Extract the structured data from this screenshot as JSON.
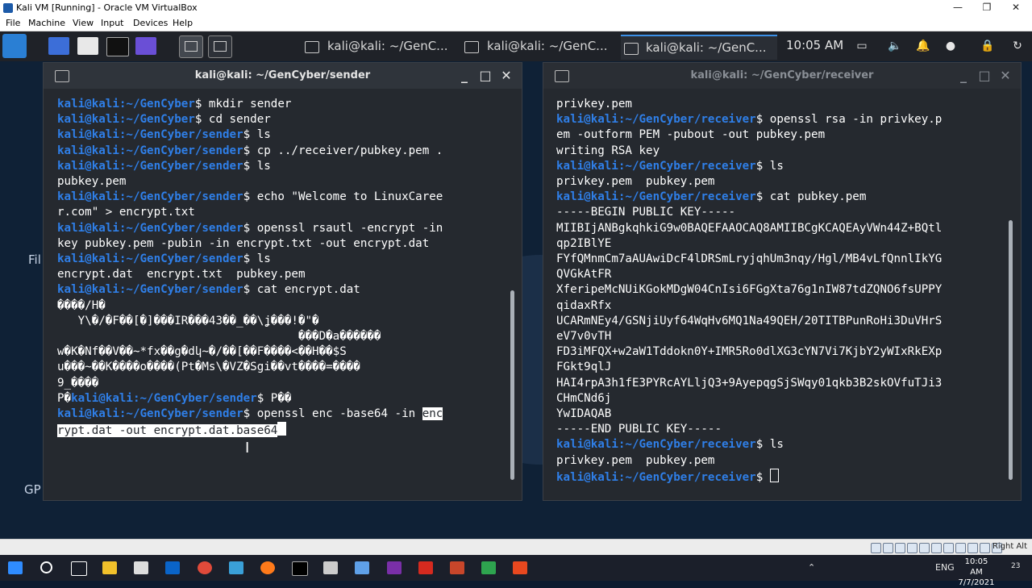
{
  "vbox": {
    "title": "Kali VM [Running] - Oracle VM VirtualBox",
    "menu": [
      "File",
      "Machine",
      "View",
      "Input",
      "Devices",
      "Help"
    ],
    "status_right": "Right Alt"
  },
  "panel": {
    "tasks": [
      "kali@kali: ~/GenC...",
      "kali@kali: ~/GenC...",
      "kali@kali: ~/GenC..."
    ],
    "time": "10:05 AM"
  },
  "desktop": {
    "labels": [
      "Fil",
      "GP"
    ]
  },
  "sender": {
    "title": "kali@kali: ~/GenCyber/sender",
    "prompt_user": "kali@kali",
    "lines": [
      {
        "path": ":~/GenCyber",
        "cmd": "$ mkdir sender"
      },
      {
        "path": ":~/GenCyber",
        "cmd": "$ cd sender"
      },
      {
        "path": ":~/GenCyber/sender",
        "cmd": "$ ls"
      },
      {
        "path": ":~/GenCyber/sender",
        "cmd": "$ cp ../receiver/pubkey.pem ."
      },
      {
        "path": ":~/GenCyber/sender",
        "cmd": "$ ls"
      },
      {
        "out": "pubkey.pem"
      },
      {
        "path": ":~/GenCyber/sender",
        "cmd": "$ echo \"Welcome to LinuxCaree"
      },
      {
        "out": "r.com\" > encrypt.txt"
      },
      {
        "path": ":~/GenCyber/sender",
        "cmd": "$ openssl rsautl -encrypt -in"
      },
      {
        "out": "key pubkey.pem -pubin -in encrypt.txt -out encrypt.dat"
      },
      {
        "path": ":~/GenCyber/sender",
        "cmd": "$ ls"
      },
      {
        "out": "encrypt.dat  encrypt.txt  pubkey.pem"
      },
      {
        "path": ":~/GenCyber/sender",
        "cmd": "$ cat encrypt.dat"
      },
      {
        "out": "����/H�"
      },
      {
        "out": "   Y\\�/�F��[�]���IR���43��_��\\ʝ���!�\"�"
      },
      {
        "out": "                                   ���D�a������"
      },
      {
        "out": "w�K�Nf��V��~*fx��g�dկ~�/��[��F����<��H��$S"
      },
      {
        "out": "u���~��K����o����(Pt�Ms\\�VZ�Sgi��vt����=����"
      },
      {
        "out": "9_����"
      },
      {
        "lead": "P�",
        "path": ":~/GenCyber/sender",
        "cmd": "$ P��"
      }
    ],
    "last_cmd_before_sel": "$ openssl enc -base64 -in ",
    "last_cmd_sel_a": "enc",
    "last_cmd_sel_b": "rypt.dat -out encrypt.dat.base64"
  },
  "receiver": {
    "title": "kali@kali: ~/GenCyber/receiver",
    "prompt_user": "kali@kali",
    "lines": [
      {
        "out": "privkey.pem"
      },
      {
        "path": ":~/GenCyber/receiver",
        "cmd": "$ openssl rsa -in privkey.p"
      },
      {
        "out": "em -outform PEM -pubout -out pubkey.pem"
      },
      {
        "out": "writing RSA key"
      },
      {
        "path": ":~/GenCyber/receiver",
        "cmd": "$ ls"
      },
      {
        "out": "privkey.pem  pubkey.pem"
      },
      {
        "path": ":~/GenCyber/receiver",
        "cmd": "$ cat pubkey.pem"
      },
      {
        "out": "-----BEGIN PUBLIC KEY-----"
      },
      {
        "out": "MIIBIjANBgkqhkiG9w0BAQEFAAOCAQ8AMIIBCgKCAQEAyVWn44Z+BQtl"
      },
      {
        "out": "qp2IBlYE"
      },
      {
        "out": "FYfQMnmCm7aAUAwiDcF4lDRSmLryjqhUm3nqy/Hgl/MB4vLfQnnlIkYG"
      },
      {
        "out": "QVGkAtFR"
      },
      {
        "out": "XferipeMcNUiKGokMDgW04CnIsi6FGgXta76g1nIW87tdZQNO6fsUPPY"
      },
      {
        "out": "qidaxRfx"
      },
      {
        "out": "UCARmNEy4/GSNjiUyf64WqHv6MQ1Na49QEH/20TITBPunRoHi3DuVHrS"
      },
      {
        "out": "eV7v0vTH"
      },
      {
        "out": "FD3iMFQX+w2aW1Tddokn0Y+IMR5Ro0dlXG3cYN7Vi7KjbY2yWIxRkEXp"
      },
      {
        "out": "FGkt9qlJ"
      },
      {
        "out": "HAI4rpA3h1fE3PYRcAYLljQ3+9AyepqgSjSWqy01qkb3B2skOVfuTJi3"
      },
      {
        "out": "CHmCNd6j"
      },
      {
        "out": "YwIDAQAB"
      },
      {
        "out": "-----END PUBLIC KEY-----"
      },
      {
        "path": ":~/GenCyber/receiver",
        "cmd": "$ ls"
      },
      {
        "out": "privkey.pem  pubkey.pem"
      },
      {
        "path": ":~/GenCyber/receiver",
        "cmd": "$ ",
        "cursor": true
      }
    ]
  },
  "taskbar": {
    "lang": "ENG",
    "time": "10:05 AM",
    "date": "7/7/2021",
    "notif_count": "23"
  }
}
